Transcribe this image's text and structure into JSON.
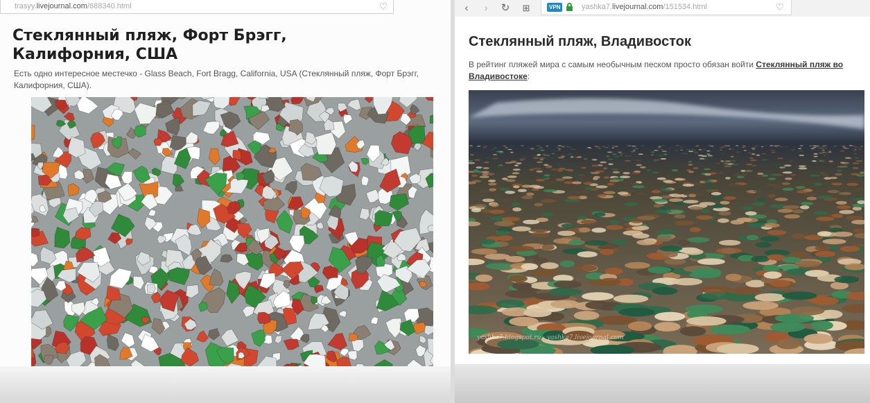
{
  "left_window": {
    "url_prefix": "trasyy.",
    "url_host": "livejournal.com",
    "url_path": "/688340.html",
    "title": "Стеклянный пляж, Форт Брэгг, Калифорния, США",
    "lead": "Есть одно интересное местечко - Glass Beach, Fort Bragg, California, USA (Стеклянный пляж, Форт Брэгг, Калифорния, США).",
    "image_icon": "sea-glass-photo"
  },
  "right_window": {
    "vpn_label": "VPN",
    "url_prefix": "yashka7.",
    "url_host": "livejournal.com",
    "url_path": "/151534.html",
    "title": "Стеклянный пляж, Владивосток",
    "lead_text": "В рейтинг пляжей мира с самым необычным песком просто обязан войти ",
    "lead_link": "Стеклянный пляж во Владивостоке",
    "lead_end": ":",
    "watermark": "yashka7.blogspot.ru · yashka7.livejournal.com",
    "image_icon": "beach-glass-photo"
  },
  "icons": {
    "back": "‹",
    "forward": "›",
    "reload": "↻",
    "grid": "⊞",
    "heart": "♡"
  },
  "colors": {
    "vpn_badge": "#1e88c8",
    "lock": "#2e9a3c"
  }
}
